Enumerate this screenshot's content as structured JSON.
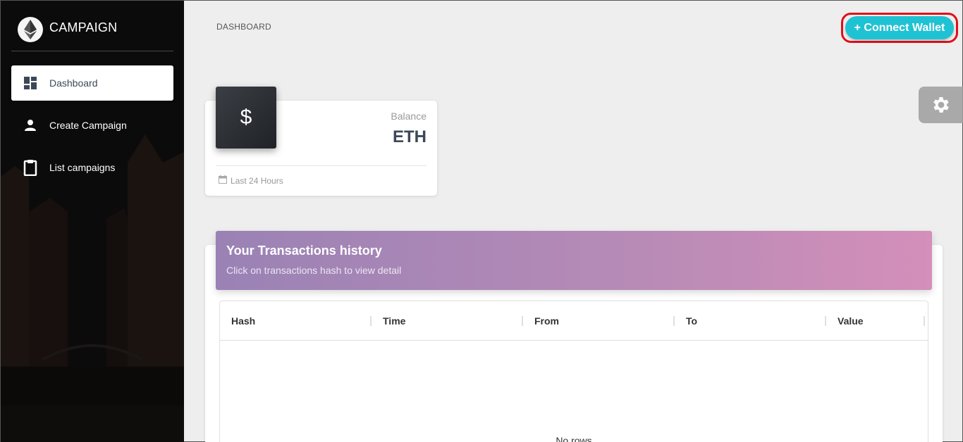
{
  "brand": {
    "title": "CAMPAIGN",
    "logo_icon": "ethereum-icon"
  },
  "sidebar": {
    "items": [
      {
        "label": "Dashboard",
        "icon": "dashboard-icon",
        "active": true
      },
      {
        "label": "Create Campaign",
        "icon": "person-icon",
        "active": false
      },
      {
        "label": "List campaigns",
        "icon": "clipboard-icon",
        "active": false
      }
    ]
  },
  "header": {
    "breadcrumb": "DASHBOARD",
    "connect_label": "+ Connect Wallet"
  },
  "balance_card": {
    "icon_symbol": "$",
    "label": "Balance",
    "value": "ETH",
    "footer": "Last 24 Hours"
  },
  "transactions": {
    "title": "Your Transactions history",
    "subtitle": "Click on transactions hash to view detail",
    "columns": [
      "Hash",
      "Time",
      "From",
      "To",
      "Value"
    ],
    "empty_text": "No rows"
  },
  "colors": {
    "accent": "#1fc2d3",
    "highlight_border": "#e0101a",
    "header_gradient_start": "#9a82b5",
    "header_gradient_end": "#d48fba"
  }
}
